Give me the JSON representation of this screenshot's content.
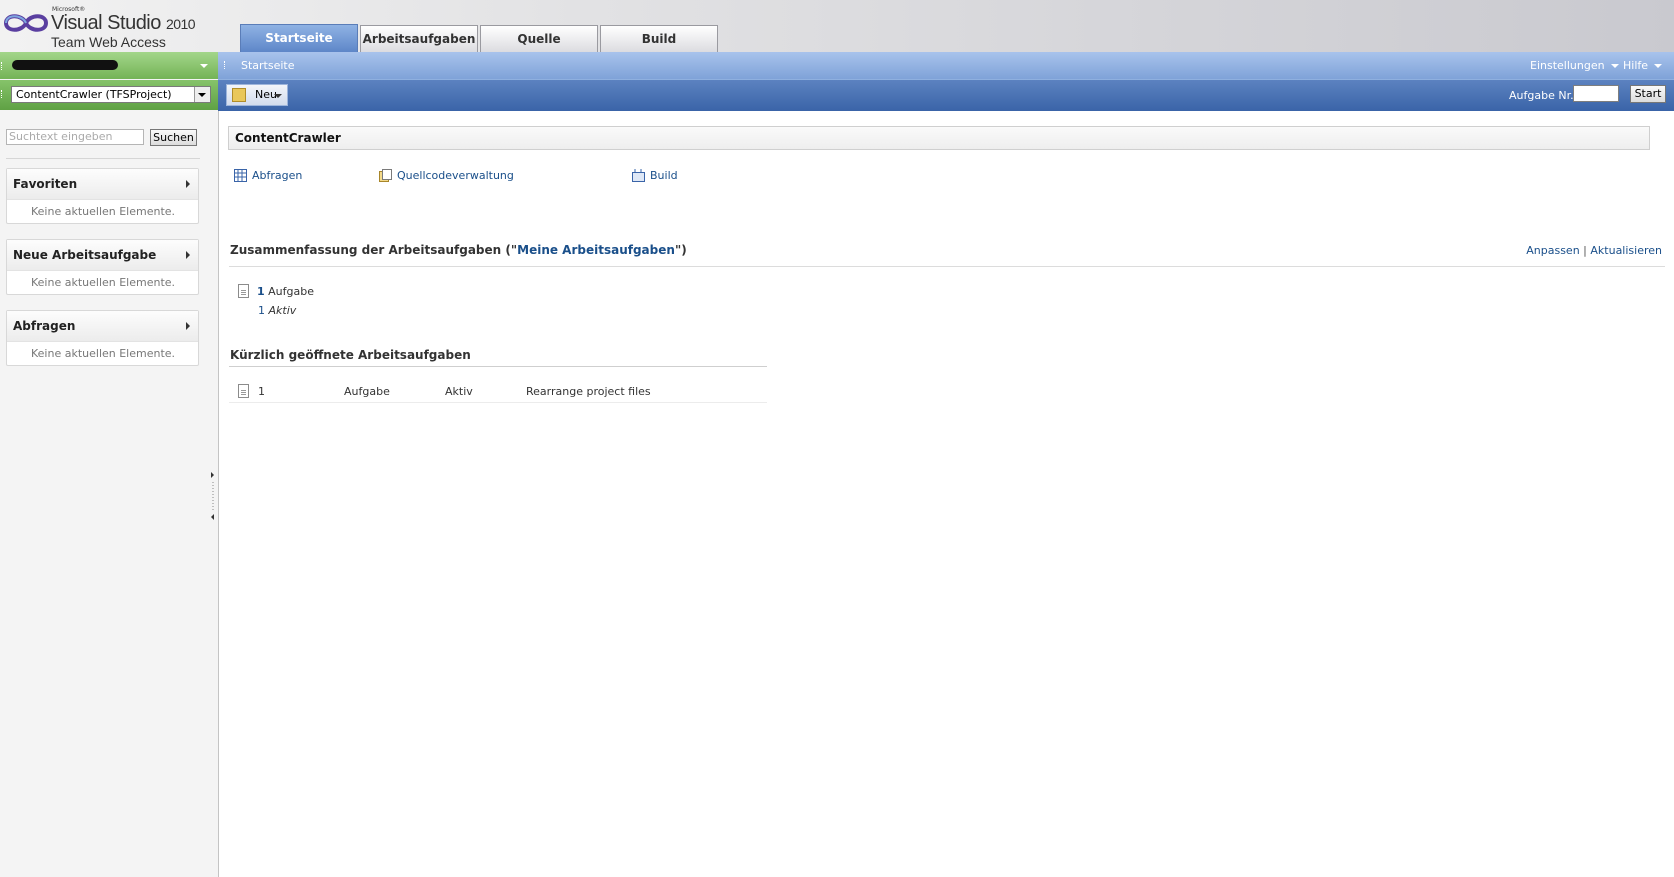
{
  "header": {
    "logo_microsoft": "Microsoft®",
    "logo_product": "Visual Studio",
    "logo_year": "2010",
    "logo_subtitle": "Team Web Access",
    "tabs": [
      {
        "label": "Startseite",
        "active": true
      },
      {
        "label": "Arbeitsaufgaben",
        "active": false
      },
      {
        "label": "Quelle",
        "active": false
      },
      {
        "label": "Build",
        "active": false
      }
    ]
  },
  "sidebar": {
    "project_selector": "ContentCrawler (TFSProject)",
    "search": {
      "placeholder": "Suchtext eingeben",
      "button": "Suchen"
    },
    "sections": [
      {
        "title": "Favoriten",
        "empty_text": "Keine aktuellen Elemente."
      },
      {
        "title": "Neue Arbeitsaufgabe",
        "empty_text": "Keine aktuellen Elemente."
      },
      {
        "title": "Abfragen",
        "empty_text": "Keine aktuellen Elemente."
      }
    ]
  },
  "navbar": {
    "breadcrumb": "Startseite",
    "settings": "Einstellungen",
    "help": "Hilfe"
  },
  "toolbar": {
    "new_button": "Neu",
    "task_label": "Aufgabe Nr.",
    "start_button": "Start"
  },
  "main": {
    "project_title": "ContentCrawler",
    "quick_links": [
      "Abfragen",
      "Quellcodeverwaltung",
      "Build"
    ],
    "summary": {
      "title_prefix": "Zusammenfassung der Arbeitsaufgaben (\"",
      "title_query": "Meine Arbeitsaufgaben",
      "title_suffix": "\")",
      "customize": "Anpassen",
      "separator": "|",
      "refresh": "Aktualisieren",
      "count": "1",
      "type": "Aufgabe",
      "sub_count": "1",
      "sub_state": "Aktiv"
    },
    "recent": {
      "title": "Kürzlich geöffnete Arbeitsaufgaben",
      "rows": [
        {
          "id": "1",
          "type": "Aufgabe",
          "state": "Aktiv",
          "title": "Rearrange project files"
        }
      ]
    }
  },
  "colors": {
    "link": "#1a4f8a",
    "nav_blue": "#7fa2d8",
    "toolbar_blue": "#3a64a8",
    "project_green": "#74b356"
  }
}
